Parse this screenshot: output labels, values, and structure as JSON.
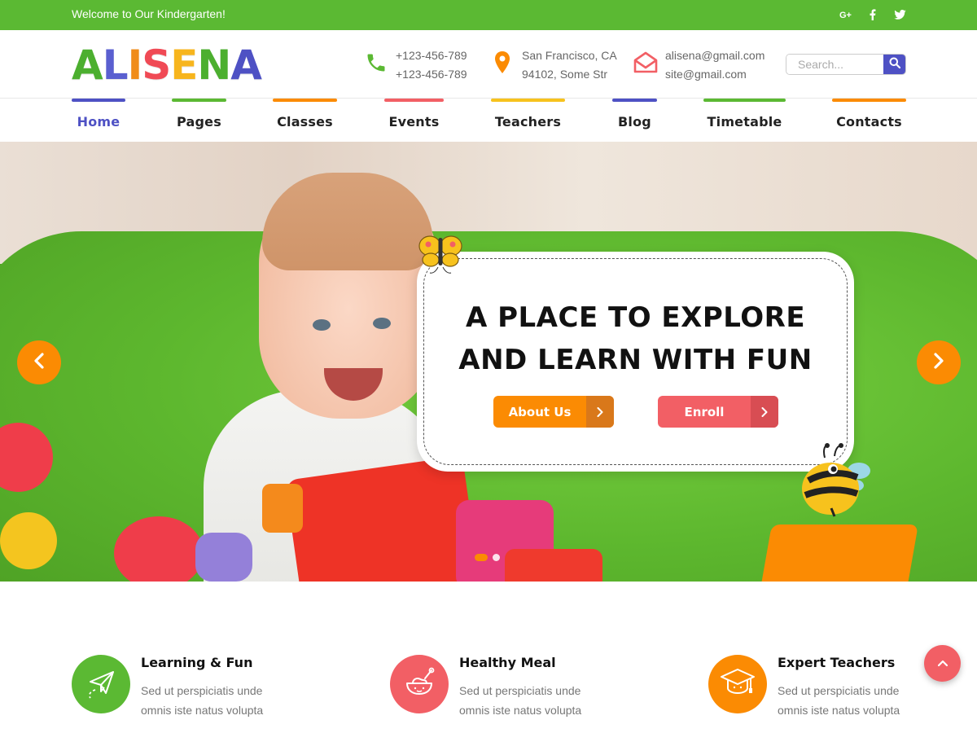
{
  "topbar": {
    "welcome": "Welcome to Our Kindergarten!",
    "social": [
      "google-plus-icon",
      "facebook-icon",
      "twitter-icon"
    ],
    "bg_color": "#5bb933"
  },
  "header": {
    "logo_letters": [
      {
        "char": "A",
        "color": "#4caf2f"
      },
      {
        "char": "L",
        "color": "#5a5fd0"
      },
      {
        "char": "I",
        "color": "#f08c1a"
      },
      {
        "char": "S",
        "color": "#f04a55"
      },
      {
        "char": "E",
        "color": "#f7b51d"
      },
      {
        "char": "N",
        "color": "#4caf2f"
      },
      {
        "char": "A",
        "color": "#4e51c4"
      }
    ],
    "phone": {
      "icon": "phone-icon",
      "line1": "+123-456-789",
      "line2": "+123-456-789"
    },
    "address": {
      "icon": "map-pin-icon",
      "line1": "San Francisco, CA",
      "line2": "94102, Some Str"
    },
    "email": {
      "icon": "envelope-icon",
      "line1": "alisena@gmail.com",
      "line2": "site@gmail.com"
    },
    "search": {
      "placeholder": "Search...",
      "icon": "search-icon"
    }
  },
  "nav": {
    "items": [
      {
        "label": "Home",
        "color": "#4e51c4",
        "active": true
      },
      {
        "label": "Pages",
        "color": "#5bb933"
      },
      {
        "label": "Classes",
        "color": "#fb8b03"
      },
      {
        "label": "Events",
        "color": "#f25f65"
      },
      {
        "label": "Teachers",
        "color": "#f7c21d"
      },
      {
        "label": "Blog",
        "color": "#4e51c4"
      },
      {
        "label": "Timetable",
        "color": "#5bb933"
      },
      {
        "label": "Contacts",
        "color": "#fb8b03"
      }
    ]
  },
  "hero": {
    "title_line1": "A PLACE TO EXPLORE",
    "title_line2": "AND LEARN WITH FUN",
    "buttons": [
      {
        "label": "About Us",
        "color": "#fb8b03",
        "arrow_color": "#d9781a"
      },
      {
        "label": "Enroll",
        "color": "#f25f65",
        "arrow_color": "#d84d53"
      }
    ],
    "slides": 2,
    "active_slide": 1
  },
  "features": [
    {
      "title": "Learning & Fun",
      "line1": "Sed ut perspiciatis unde",
      "line2": "omnis iste natus volupta",
      "icon": "paper-plane-icon",
      "color": "#5bb933"
    },
    {
      "title": "Healthy Meal",
      "line1": "Sed ut perspiciatis unde",
      "line2": "omnis iste natus volupta",
      "icon": "meal-bowl-icon",
      "color": "#f25f65"
    },
    {
      "title": "Expert Teachers",
      "line1": "Sed ut perspiciatis unde",
      "line2": "omnis iste natus volupta",
      "icon": "graduation-cap-icon",
      "color": "#fb8b03"
    }
  ],
  "colors": {
    "primary": "#4e51c4",
    "green": "#5bb933",
    "orange": "#fb8b03",
    "red": "#f25f65"
  }
}
